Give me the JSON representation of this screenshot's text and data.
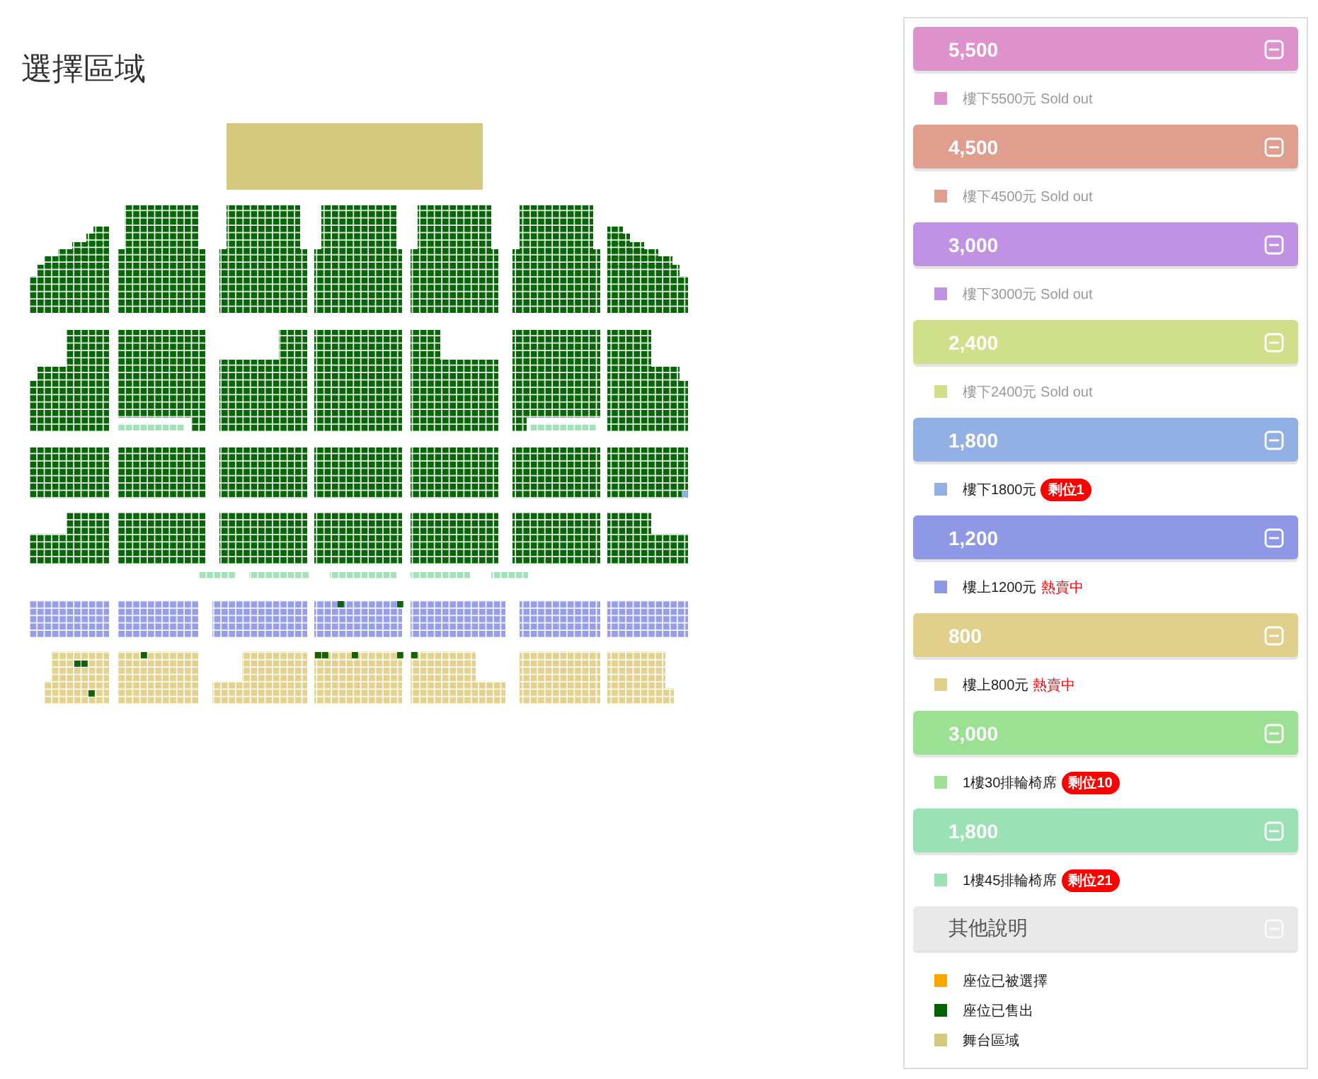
{
  "title": "選擇區域",
  "sections": [
    {
      "kind": "price",
      "title": "5,500",
      "color": "#dd92cb",
      "items": [
        {
          "kind": "sold_out",
          "label": "樓下5500元 Sold out",
          "color": "#dd92cb"
        }
      ]
    },
    {
      "kind": "price",
      "title": "4,500",
      "color": "#e09e8f",
      "items": [
        {
          "kind": "sold_out",
          "label": "樓下4500元 Sold out",
          "color": "#e09e8f"
        }
      ]
    },
    {
      "kind": "price",
      "title": "3,000",
      "color": "#bf92e4",
      "items": [
        {
          "kind": "sold_out",
          "label": "樓下3000元 Sold out",
          "color": "#bf92e4"
        }
      ]
    },
    {
      "kind": "price",
      "title": "2,400",
      "color": "#cfdf8a",
      "items": [
        {
          "kind": "sold_out",
          "label": "樓下2400元 Sold out",
          "color": "#cfdf8a"
        }
      ]
    },
    {
      "kind": "price",
      "title": "1,800",
      "color": "#92b0e4",
      "items": [
        {
          "kind": "remaining",
          "label": "樓下1800元",
          "note": "剩位1",
          "color": "#92b0e4"
        }
      ]
    },
    {
      "kind": "price",
      "title": "1,200",
      "color": "#8f98e4",
      "items": [
        {
          "kind": "hot",
          "label": "樓上1200元",
          "note": "熱賣中",
          "color": "#8f98e4"
        }
      ]
    },
    {
      "kind": "price",
      "title": "800",
      "color": "#e0d08c",
      "items": [
        {
          "kind": "hot",
          "label": "樓上800元",
          "note": "熱賣中",
          "color": "#e0d08c"
        }
      ]
    },
    {
      "kind": "price",
      "title": "3,000",
      "color": "#9ce094",
      "items": [
        {
          "kind": "remaining",
          "label": "1樓30排輪椅席",
          "note": "剩位10",
          "color": "#9ce094"
        }
      ]
    },
    {
      "kind": "price",
      "title": "1,800",
      "color": "#9ce0b5",
      "items": [
        {
          "kind": "remaining",
          "label": "1樓45排輪椅席",
          "note": "剩位21",
          "color": "#9ce0b5"
        }
      ]
    },
    {
      "kind": "info",
      "title": "其他說明",
      "items": [
        {
          "kind": "legend",
          "label": "座位已被選擇",
          "color": "#ffa500"
        },
        {
          "kind": "legend",
          "label": "座位已售出",
          "color": "#006400"
        },
        {
          "kind": "legend",
          "label": "舞台區域",
          "color": "#d3c97e"
        }
      ]
    }
  ]
}
